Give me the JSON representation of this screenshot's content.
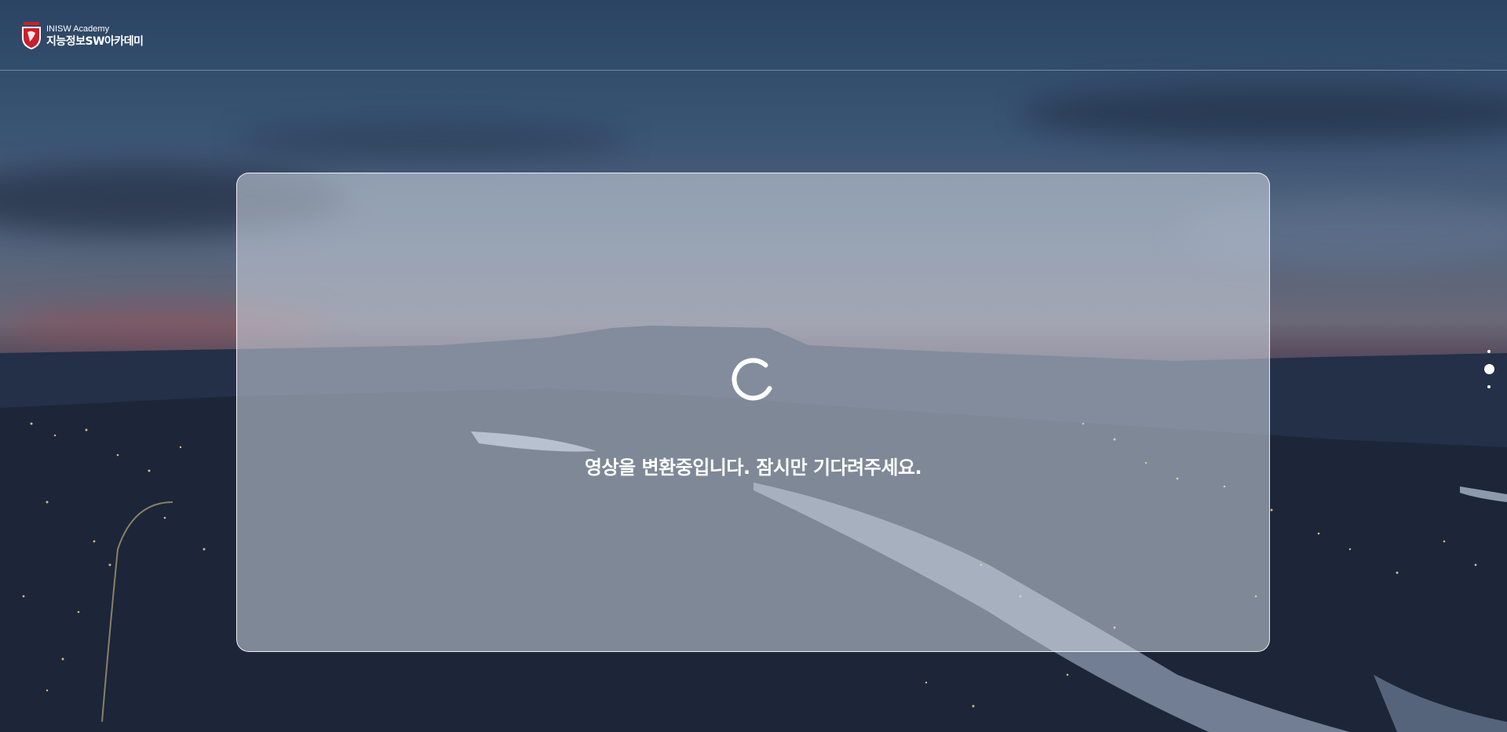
{
  "header": {
    "logo_en": "INISW Academy",
    "logo_ko": "지능정보SW아카데미"
  },
  "status": {
    "message": "영상을 변환중입니다. 잠시만 기다려주세요."
  },
  "pagination": {
    "count": 3,
    "active_index": 1
  },
  "colors": {
    "accent": "#ffffff",
    "emblem_red": "#c8202f"
  },
  "icons": {
    "logo": "shield-emblem-icon",
    "loading": "loading-spinner-icon"
  }
}
